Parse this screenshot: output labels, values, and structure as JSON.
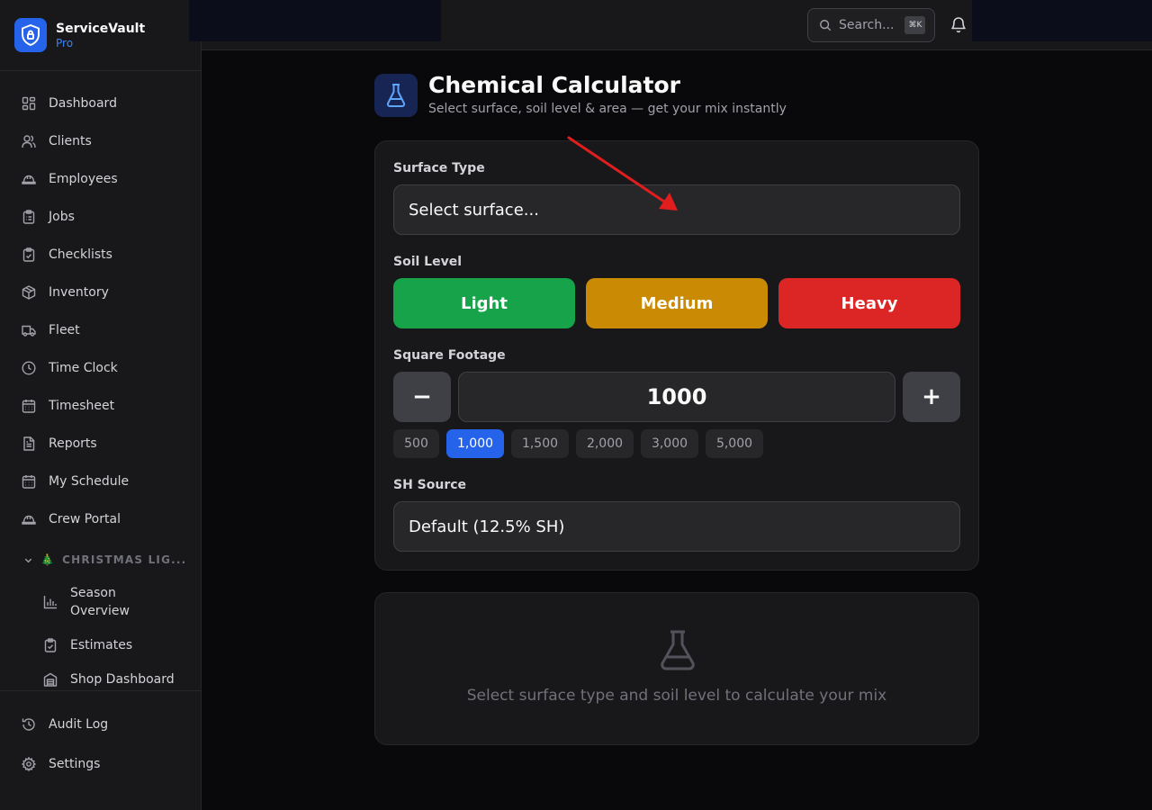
{
  "brand": {
    "name": "ServiceVault",
    "plan": "Pro"
  },
  "nav": {
    "items": [
      {
        "label": "Dashboard",
        "icon": "dashboard-icon"
      },
      {
        "label": "Clients",
        "icon": "users-icon"
      },
      {
        "label": "Employees",
        "icon": "hard-hat-icon"
      },
      {
        "label": "Jobs",
        "icon": "clipboard-list-icon"
      },
      {
        "label": "Checklists",
        "icon": "clipboard-check-icon"
      },
      {
        "label": "Inventory",
        "icon": "package-icon"
      },
      {
        "label": "Fleet",
        "icon": "truck-icon"
      },
      {
        "label": "Time Clock",
        "icon": "clock-icon"
      },
      {
        "label": "Timesheet",
        "icon": "calendar-icon"
      },
      {
        "label": "Reports",
        "icon": "file-text-icon"
      },
      {
        "label": "My Schedule",
        "icon": "calendar-icon"
      },
      {
        "label": "Crew Portal",
        "icon": "hard-hat-icon"
      }
    ],
    "section": {
      "label": "CHRISTMAS LIG...",
      "emoji": "🎄"
    },
    "sub_items": [
      {
        "label": "Season Overview",
        "icon": "bar-chart-icon"
      },
      {
        "label": "Estimates",
        "icon": "clipboard-check-icon"
      },
      {
        "label": "Shop Dashboard",
        "icon": "warehouse-icon"
      }
    ],
    "bottom": [
      {
        "label": "Audit Log",
        "icon": "history-icon"
      },
      {
        "label": "Settings",
        "icon": "gear-icon"
      }
    ]
  },
  "topbar": {
    "search_placeholder": "Search...",
    "shortcut": "⌘K"
  },
  "page": {
    "title": "Chemical Calculator",
    "subtitle": "Select surface, soil level & area — get your mix instantly"
  },
  "form": {
    "surface_label": "Surface Type",
    "surface_value": "Select surface...",
    "soil_label": "Soil Level",
    "soil_levels": [
      {
        "label": "Light",
        "color": "#16a34a"
      },
      {
        "label": "Medium",
        "color": "#ca8a04"
      },
      {
        "label": "Heavy",
        "color": "#dc2626"
      }
    ],
    "sqft_label": "Square Footage",
    "sqft_value": "1000",
    "minus": "−",
    "plus": "+",
    "presets": [
      "500",
      "1,000",
      "1,500",
      "2,000",
      "3,000",
      "5,000"
    ],
    "active_preset": "1,000",
    "sh_label": "SH Source",
    "sh_value": "Default (12.5% SH)"
  },
  "result": {
    "empty_text": "Select surface type and soil level to calculate your mix"
  },
  "colors": {
    "accent": "#2563eb",
    "background": "#09090b",
    "panel": "#18181b",
    "annotation_arrow": "#e11d1d"
  }
}
